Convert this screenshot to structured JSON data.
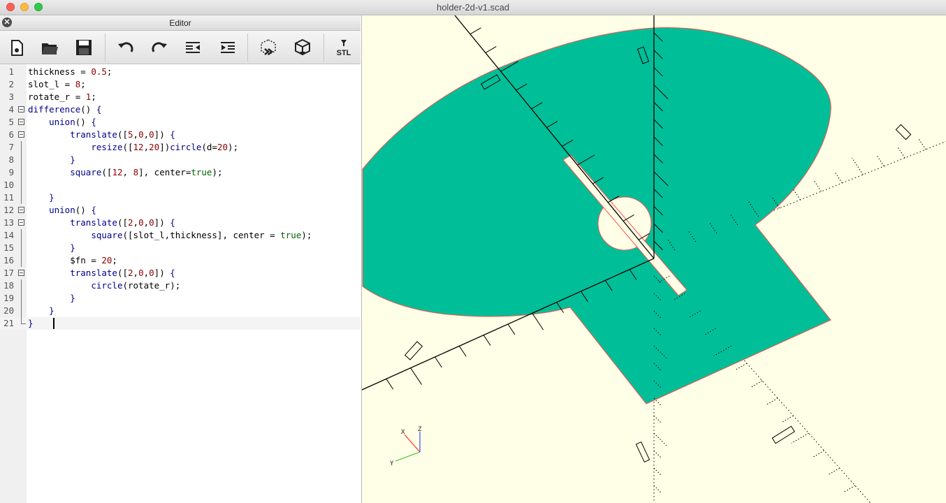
{
  "window": {
    "title": "holder-2d-v1.scad"
  },
  "editor": {
    "title": "Editor",
    "close_glyph": "✕",
    "toolbar": [
      {
        "name": "new-file-icon"
      },
      {
        "name": "open-file-icon"
      },
      {
        "name": "save-icon"
      },
      {
        "name": "undo-icon"
      },
      {
        "name": "redo-icon"
      },
      {
        "name": "unindent-icon"
      },
      {
        "name": "indent-icon"
      },
      {
        "name": "preview-icon"
      },
      {
        "name": "render-icon"
      },
      {
        "name": "export-stl-icon",
        "label": "STL"
      }
    ],
    "lines": [
      {
        "n": "1",
        "text": "thickness = 0.5;"
      },
      {
        "n": "2",
        "text": "slot_l = 8;"
      },
      {
        "n": "3",
        "text": "rotate_r = 1;"
      },
      {
        "n": "4",
        "text": "difference() {"
      },
      {
        "n": "5",
        "text": "    union() {"
      },
      {
        "n": "6",
        "text": "        translate([5,0,0]) {"
      },
      {
        "n": "7",
        "text": "            resize([12,20])circle(d=20);"
      },
      {
        "n": "8",
        "text": "        }"
      },
      {
        "n": "9",
        "text": "        square([12, 8], center=true);"
      },
      {
        "n": "10",
        "text": ""
      },
      {
        "n": "11",
        "text": "    }"
      },
      {
        "n": "12",
        "text": "    union() {"
      },
      {
        "n": "13",
        "text": "        translate([2,0,0]) {"
      },
      {
        "n": "14",
        "text": "            square([slot_l,thickness], center = true);"
      },
      {
        "n": "15",
        "text": "        }"
      },
      {
        "n": "16",
        "text": "        $fn = 20;"
      },
      {
        "n": "17",
        "text": "        translate([2,0,0]) {"
      },
      {
        "n": "18",
        "text": "            circle(rotate_r);"
      },
      {
        "n": "19",
        "text": "        }"
      },
      {
        "n": "20",
        "text": "    }"
      },
      {
        "n": "21",
        "text": "}"
      }
    ]
  },
  "viewer": {
    "colors": {
      "background": "#fffee6",
      "shape": "#00bf98",
      "outline": "#ff4b4b",
      "axis": "#000000"
    },
    "axes_indicator": {
      "x": "X",
      "y": "Y",
      "z": "Z"
    }
  }
}
